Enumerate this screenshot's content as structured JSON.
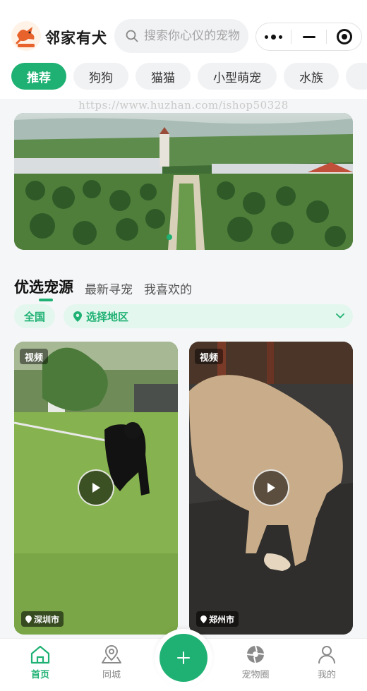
{
  "header": {
    "app_name": "邻家有犬",
    "search_placeholder": "搜索你心仪的宠物",
    "logo_icon": "dog-logo-icon"
  },
  "categories": [
    {
      "label": "推荐",
      "active": true
    },
    {
      "label": "狗狗",
      "active": false
    },
    {
      "label": "猫猫",
      "active": false
    },
    {
      "label": "小型萌宠",
      "active": false
    },
    {
      "label": "水族",
      "active": false
    }
  ],
  "watermark": "https://www.huzhan.com/ishop50328",
  "sections": {
    "tabs": [
      "优选宠源",
      "最新寻宠",
      "我喜欢的"
    ],
    "active_index": 0
  },
  "filters": {
    "scope": "全国",
    "region": "选择地区"
  },
  "cards": [
    {
      "tag": "视频",
      "location": "深圳市"
    },
    {
      "tag": "视频",
      "location": "郑州市"
    }
  ],
  "tabbar": {
    "items": [
      "首页",
      "同城",
      "宠物圈",
      "我的"
    ],
    "active_index": 0
  },
  "colors": {
    "accent": "#1fb173",
    "accent_light": "#e3f7ee"
  }
}
